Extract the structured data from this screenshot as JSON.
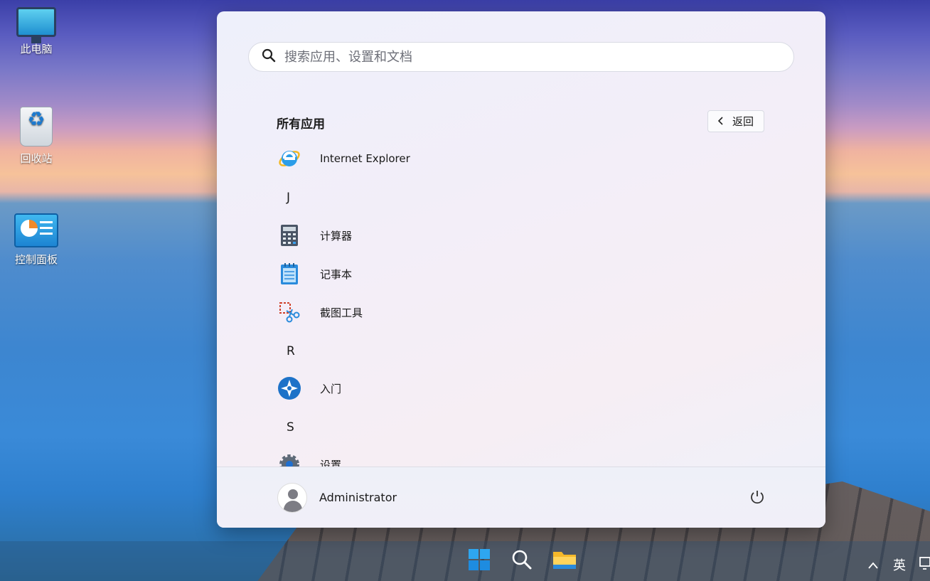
{
  "desktop": {
    "icons": [
      {
        "label": "此电脑",
        "icon": "this-pc-icon"
      },
      {
        "label": "回收站",
        "icon": "recycle-bin-icon"
      },
      {
        "label": "控制面板",
        "icon": "control-panel-icon"
      }
    ]
  },
  "start_menu": {
    "search": {
      "placeholder": "搜索应用、设置和文档",
      "value": ""
    },
    "section_title": "所有应用",
    "back_label": "返回",
    "apps": [
      {
        "label": "Internet Explorer",
        "icon": "internet-explorer-icon"
      },
      {
        "letter": "J"
      },
      {
        "label": "计算器",
        "icon": "calculator-icon"
      },
      {
        "label": "记事本",
        "icon": "notepad-icon"
      },
      {
        "label": "截图工具",
        "icon": "snipping-tool-icon"
      },
      {
        "letter": "R"
      },
      {
        "label": "入门",
        "icon": "get-started-icon"
      },
      {
        "letter": "S"
      },
      {
        "label": "设置",
        "icon": "settings-icon"
      }
    ],
    "user": {
      "name": "Administrator"
    }
  },
  "taskbar": {
    "items": [
      "start-icon",
      "search-icon",
      "file-explorer-icon"
    ],
    "tray": {
      "input_method": "英"
    }
  },
  "colors": {
    "accent": "#0067c0",
    "text": "#1a1a1a"
  }
}
